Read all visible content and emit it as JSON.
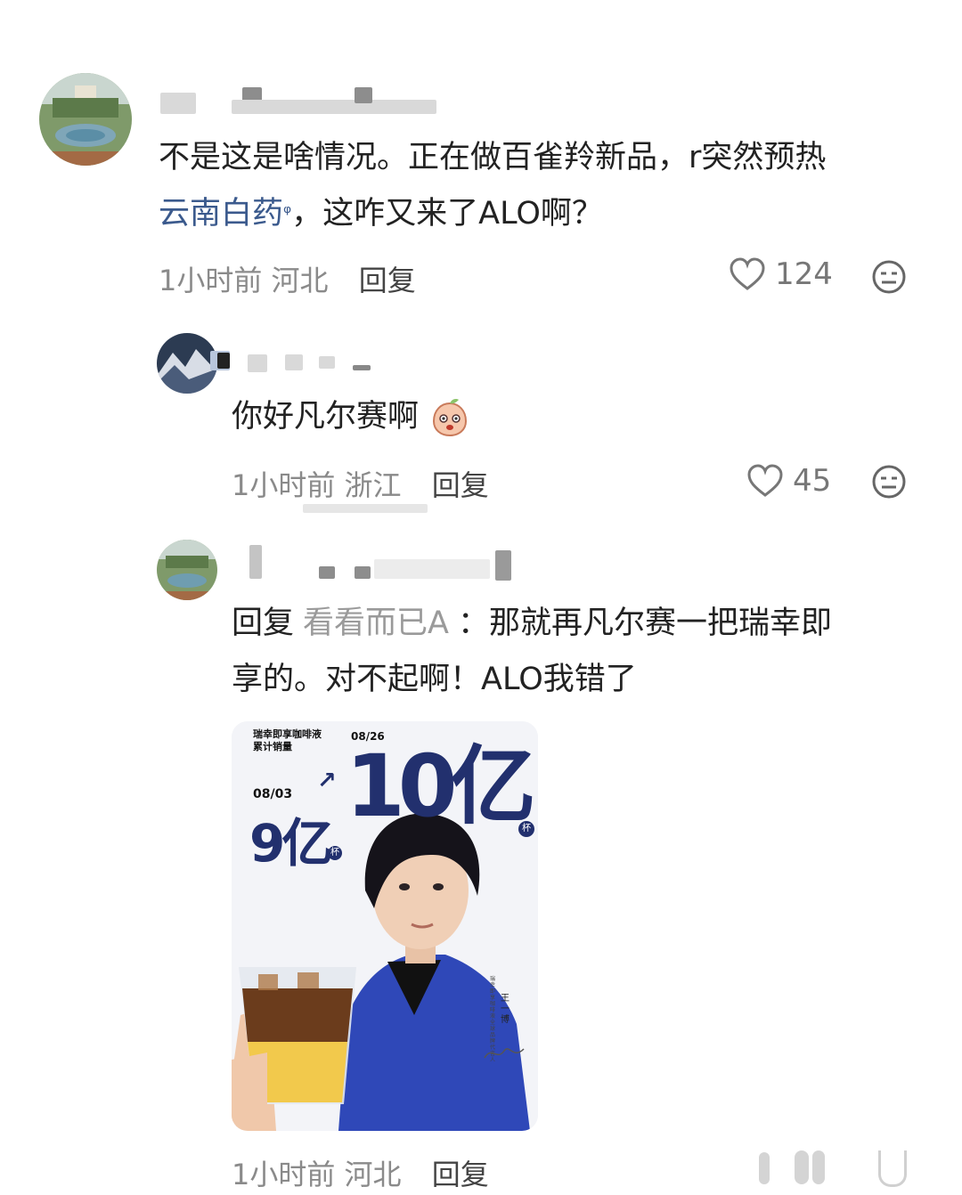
{
  "comments": [
    {
      "text_line1": "不是这是啥情况。正在做百雀羚新品，r突然预热",
      "link": "云南白药",
      "search_icon": "ᵠ",
      "text_line2_rest": "，这咋又来了ALO啊？",
      "time": "1小时前",
      "location": "河北",
      "reply_label": "回复",
      "likes": "124"
    },
    {
      "text": "你好凡尔赛啊",
      "time": "1小时前",
      "location": "浙江",
      "reply_label": "回复",
      "likes": "45"
    },
    {
      "reply_prefix": "回复",
      "mention": "看看而已A",
      "colon": "：",
      "text_line1": "那就再凡尔赛一把瑞幸即",
      "text_line2": "享的。对不起啊！ALO我错了",
      "time": "1小时前",
      "location": "河北",
      "reply_label": "回复"
    }
  ],
  "poster": {
    "header_line1": "瑞幸即享咖啡液",
    "header_line2": "累计销量",
    "date_start": "08/03",
    "date_end": "08/26",
    "value_start": "9亿",
    "value_end": "10亿",
    "unit": "杯",
    "side_caption": "瑞幸即享咖啡液全球品牌代言人",
    "person_name": "王一博"
  },
  "colors": {
    "link": "#3b5a8d",
    "meta": "#8a8a8a",
    "poster_blue": "#22306e"
  }
}
